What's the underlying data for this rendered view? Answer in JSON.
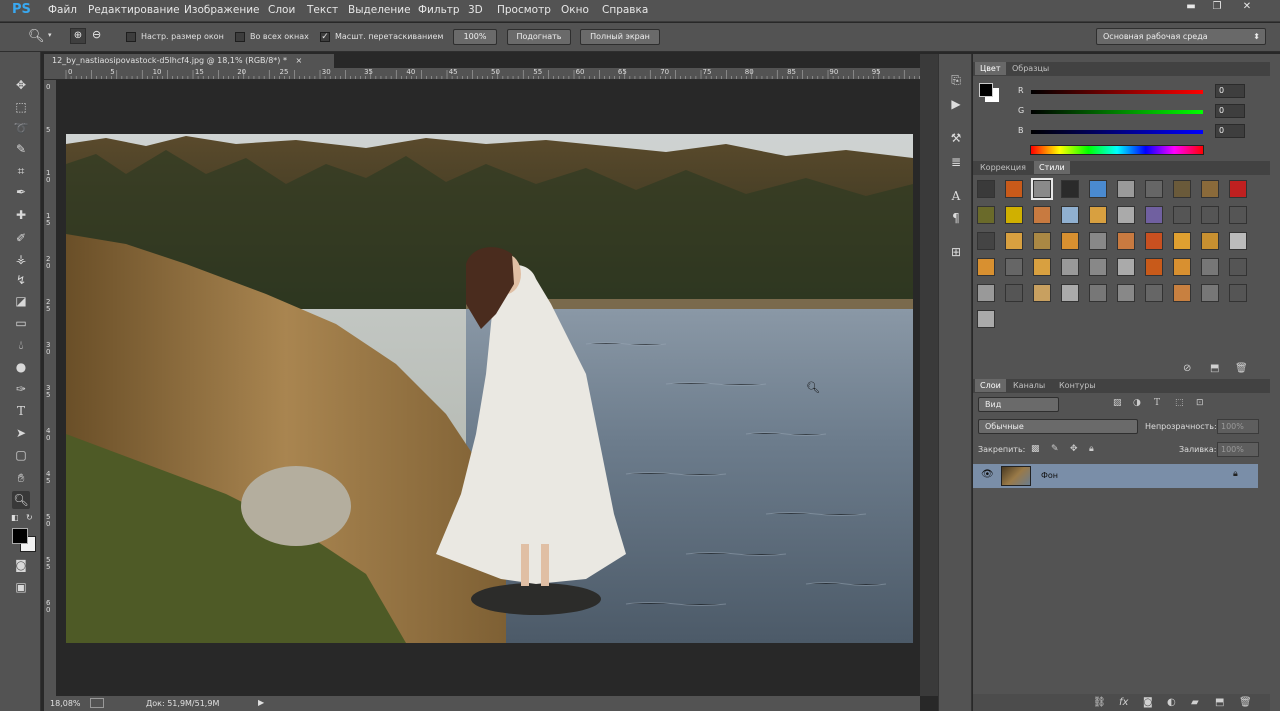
{
  "app": {
    "logo": "PS"
  },
  "menu": [
    "Файл",
    "Редактирование",
    "Изображение",
    "Слои",
    "Текст",
    "Выделение",
    "Фильтр",
    "3D",
    "Просмотр",
    "Окно",
    "Справка"
  ],
  "window_controls": {
    "minimize": "▬",
    "restore": "❐",
    "close": "✕"
  },
  "options": {
    "resize_windows": "Настр. размер окон",
    "all_windows": "Во всех окнах",
    "scrubby_zoom": "Масшт. перетаскиванием",
    "scrubby_checked": "✓",
    "btn_100": "100%",
    "btn_fit": "Подогнать",
    "btn_fullscreen": "Полный экран",
    "workspace": "Основная рабочая среда"
  },
  "document": {
    "tab_title": "12_by_nastiaosipovastock-d5lhcf4.jpg @ 18,1% (RGB/8*) *",
    "close": "×"
  },
  "ruler_h": [
    "0",
    "5",
    "10",
    "15",
    "20",
    "25",
    "30",
    "35",
    "40",
    "45",
    "50",
    "55",
    "60",
    "65",
    "70",
    "75",
    "80",
    "85",
    "90",
    "95"
  ],
  "ruler_v": [
    "0",
    "5",
    "1 0",
    "1 5",
    "2 0",
    "2 5",
    "3 0",
    "3 5",
    "4 0",
    "4 5",
    "5 0",
    "5 5",
    "6 0"
  ],
  "status": {
    "zoom": "18,08%",
    "doc": "Док: 51,9M/51,9M"
  },
  "color_panel": {
    "tabs": [
      "Цвет",
      "Образцы"
    ],
    "channels": [
      {
        "label": "R",
        "value": "0"
      },
      {
        "label": "G",
        "value": "0"
      },
      {
        "label": "B",
        "value": "0"
      }
    ]
  },
  "styles_panel": {
    "tabs": [
      "Коррекция",
      "Стили"
    ]
  },
  "layers_panel": {
    "tabs": [
      "Слои",
      "Каналы",
      "Контуры"
    ],
    "filter_kind": "Вид",
    "blend_mode": "Обычные",
    "opacity_label": "Непрозрачность:",
    "opacity_value": "100%",
    "lock_label": "Закрепить:",
    "fill_label": "Заливка:",
    "fill_value": "100%",
    "layers": [
      {
        "name": "Фон"
      }
    ]
  },
  "colors": {
    "accent": "#39a8f0",
    "ui_bg": "#535353",
    "layer_selected": "#7a8ea8"
  }
}
